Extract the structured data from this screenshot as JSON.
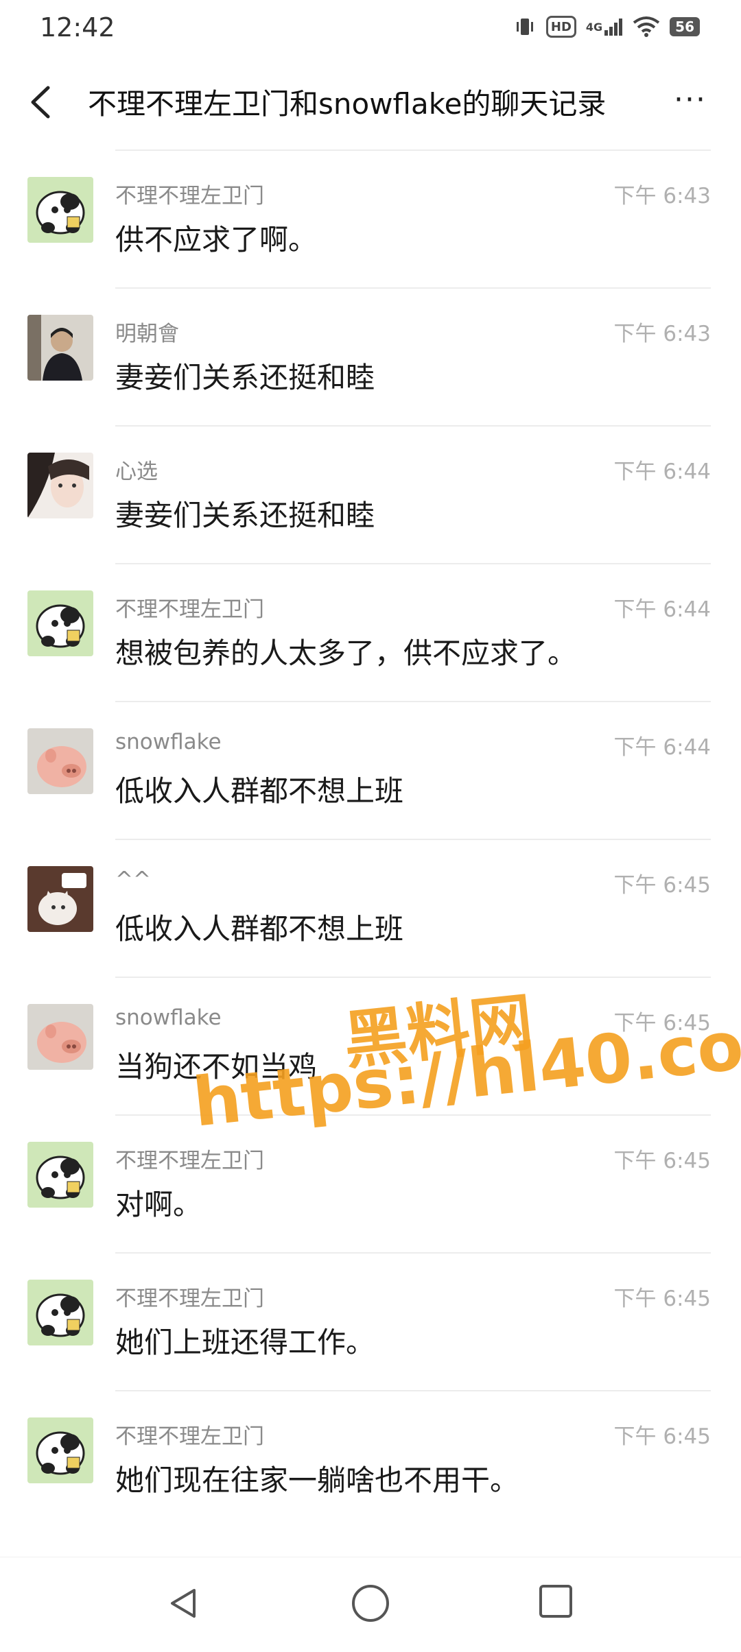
{
  "status_bar": {
    "time": "12:42",
    "network": "4G",
    "hd": "HD",
    "battery": "56"
  },
  "header": {
    "title": "不理不理左卫门和snowflake的聊天记录",
    "more": "···"
  },
  "messages": [
    {
      "sender": "不理不理左卫门",
      "time": "下午 6:43",
      "text": "供不应求了啊。",
      "avatar": "panda-avatar"
    },
    {
      "sender": "明朝會",
      "time": "下午 6:43",
      "text": "妻妾们关系还挺和睦",
      "avatar": "person-avatar"
    },
    {
      "sender": "心选",
      "time": "下午 6:44",
      "text": "妻妾们关系还挺和睦",
      "avatar": "girl-avatar"
    },
    {
      "sender": "不理不理左卫门",
      "time": "下午 6:44",
      "text": "想被包养的人太多了，供不应求了。",
      "avatar": "panda-avatar"
    },
    {
      "sender": "snowflake",
      "time": "下午 6:44",
      "text": "低收入人群都不想上班",
      "avatar": "pig-avatar"
    },
    {
      "sender": "^^",
      "time": "下午 6:45",
      "text": "低收入人群都不想上班",
      "avatar": "cat-avatar"
    },
    {
      "sender": "snowflake",
      "time": "下午 6:45",
      "text": "当狗还不如当鸡",
      "avatar": "pig-avatar"
    },
    {
      "sender": "不理不理左卫门",
      "time": "下午 6:45",
      "text": "对啊。",
      "avatar": "panda-avatar"
    },
    {
      "sender": "不理不理左卫门",
      "time": "下午 6:45",
      "text": "她们上班还得工作。",
      "avatar": "panda-avatar"
    },
    {
      "sender": "不理不理左卫门",
      "time": "下午 6:45",
      "text": "她们现在往家一躺啥也不用干。",
      "avatar": "panda-avatar"
    }
  ],
  "watermark": {
    "line1": "黑料网",
    "line2": "https://hl40.co"
  }
}
